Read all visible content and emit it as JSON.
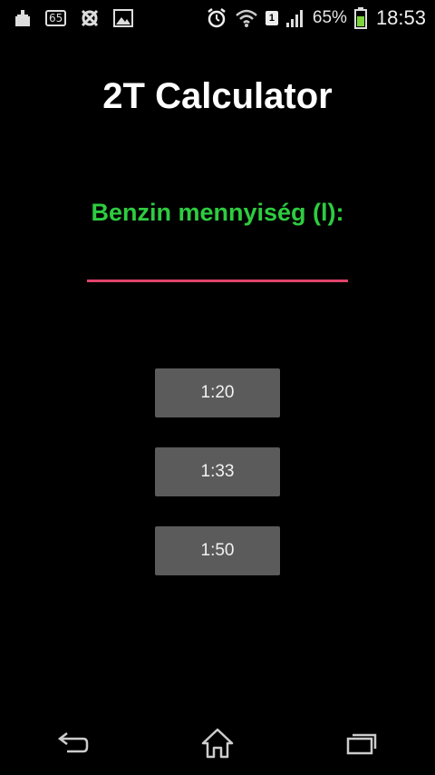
{
  "status_bar": {
    "notification_badge": "65",
    "sim_label": "1",
    "battery_percent": "65%",
    "time": "18:53",
    "icons": [
      "cleaner-icon",
      "badge-65-icon",
      "avast-icon",
      "image-icon",
      "alarm-icon",
      "wifi-icon",
      "sim-icon",
      "signal-icon",
      "battery-icon"
    ]
  },
  "app": {
    "title": "2T Calculator",
    "field_label": "Benzin mennyiség (l):",
    "input_value": "",
    "input_placeholder": ""
  },
  "buttons": [
    {
      "label": "1:20"
    },
    {
      "label": "1:33"
    },
    {
      "label": "1:50"
    }
  ],
  "nav": {
    "icons": [
      "back-icon",
      "home-icon",
      "recent-apps-icon"
    ]
  },
  "colors": {
    "background": "#000000",
    "label_green": "#2ecc40",
    "input_underline": "#e0436a",
    "button_bg": "#5b5b5b"
  }
}
